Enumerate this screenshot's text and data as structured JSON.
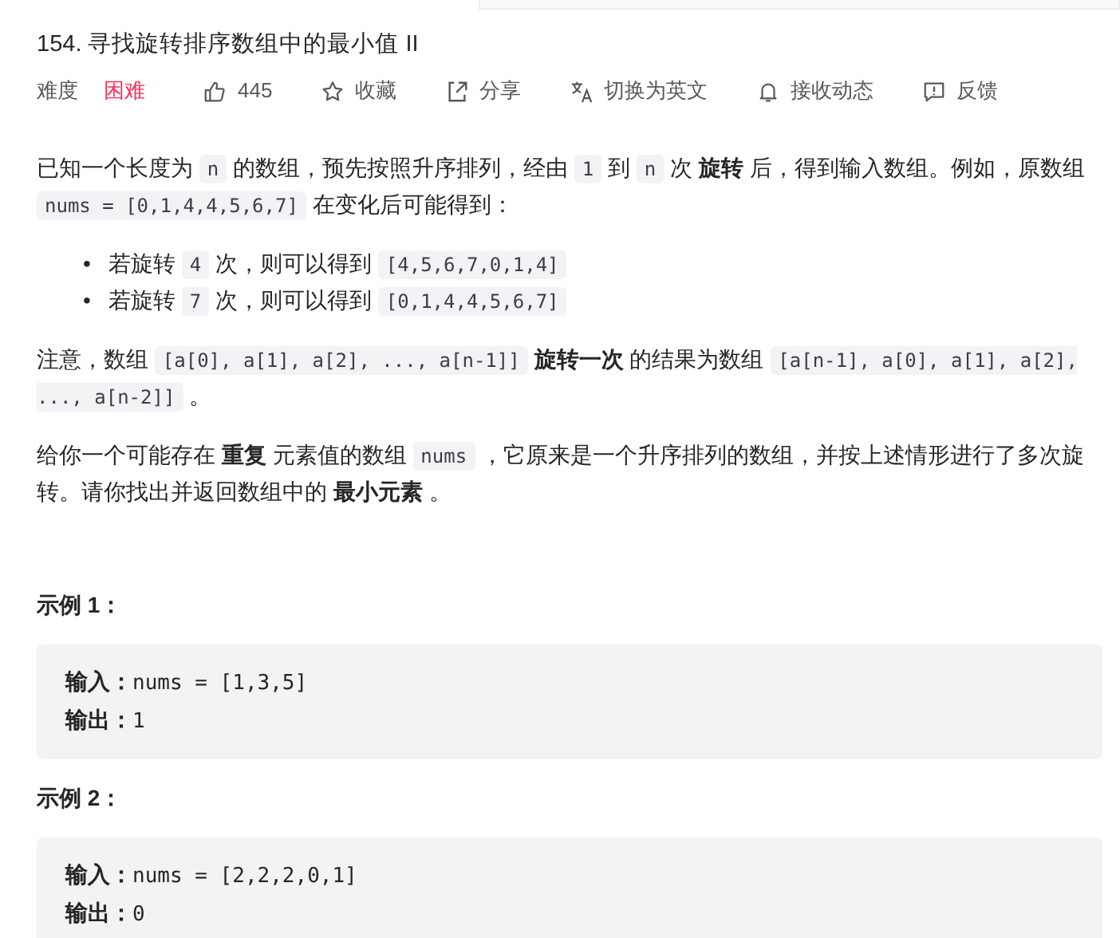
{
  "title": "154. 寻找旋转排序数组中的最小值 II",
  "difficulty": {
    "label": "难度",
    "value": "困难",
    "kind": "hard"
  },
  "actions": [
    {
      "kind": "like",
      "label": "445"
    },
    {
      "kind": "star",
      "label": "收藏"
    },
    {
      "kind": "share",
      "label": "分享"
    },
    {
      "kind": "translate",
      "label": "切换为英文"
    },
    {
      "kind": "bell",
      "label": "接收动态"
    },
    {
      "kind": "feedback",
      "label": "反馈"
    }
  ],
  "description": [
    {
      "kind": "paragraph",
      "segments": [
        {
          "kind": "text",
          "text": "已知一个长度为 "
        },
        {
          "kind": "code",
          "text": "n"
        },
        {
          "kind": "text",
          "text": " 的数组，预先按照升序排列，经由 "
        },
        {
          "kind": "code",
          "text": "1"
        },
        {
          "kind": "text",
          "text": " 到 "
        },
        {
          "kind": "code",
          "text": "n"
        },
        {
          "kind": "text",
          "text": " 次 "
        },
        {
          "kind": "bold",
          "text": "旋转"
        },
        {
          "kind": "text",
          "text": " 后，得到输入数组。例如，原数组 "
        },
        {
          "kind": "code",
          "text": "nums = [0,1,4,4,5,6,7]"
        },
        {
          "kind": "text",
          "text": " 在变化后可能得到："
        }
      ]
    },
    {
      "kind": "bullets",
      "items": [
        {
          "marker": "•",
          "segments": [
            {
              "kind": "text",
              "text": "若旋转 "
            },
            {
              "kind": "code",
              "text": "4"
            },
            {
              "kind": "text",
              "text": " 次，则可以得到 "
            },
            {
              "kind": "code",
              "text": "[4,5,6,7,0,1,4]"
            }
          ]
        },
        {
          "marker": "•",
          "segments": [
            {
              "kind": "text",
              "text": "若旋转 "
            },
            {
              "kind": "code",
              "text": "7"
            },
            {
              "kind": "text",
              "text": " 次，则可以得到 "
            },
            {
              "kind": "code",
              "text": "[0,1,4,4,5,6,7]"
            }
          ]
        }
      ]
    },
    {
      "kind": "paragraph",
      "segments": [
        {
          "kind": "text",
          "text": "注意，数组 "
        },
        {
          "kind": "code",
          "text": "[a[0], a[1], a[2], ..., a[n-1]]"
        },
        {
          "kind": "bold",
          "text": "旋转一次"
        },
        {
          "kind": "text",
          "text": " 的结果为数组 "
        },
        {
          "kind": "code",
          "text": "[a[n-1], a[0], a[1], a[2], ..., a[n-2]]"
        },
        {
          "kind": "text",
          "text": " 。"
        }
      ]
    },
    {
      "kind": "paragraph",
      "segments": [
        {
          "kind": "text",
          "text": "给你一个可能存在 "
        },
        {
          "kind": "bold",
          "text": "重复"
        },
        {
          "kind": "text",
          "text": " 元素值的数组 "
        },
        {
          "kind": "code",
          "text": "nums"
        },
        {
          "kind": "text",
          "text": " ，它原来是一个升序排列的数组，并按上述情形进行了多次旋转。请你找出并返回数组中的 "
        },
        {
          "kind": "bold",
          "text": "最小元素"
        },
        {
          "kind": "text",
          "text": " 。"
        }
      ]
    }
  ],
  "examples": [
    {
      "title": "示例 1：",
      "lines": [
        {
          "label": "输入：",
          "value": "nums = [1,3,5]"
        },
        {
          "label": "输出：",
          "value": "1"
        }
      ]
    },
    {
      "title": "示例 2：",
      "lines": [
        {
          "label": "输入：",
          "value": "nums = [2,2,2,0,1]"
        },
        {
          "label": "输出：",
          "value": "0"
        }
      ]
    }
  ]
}
